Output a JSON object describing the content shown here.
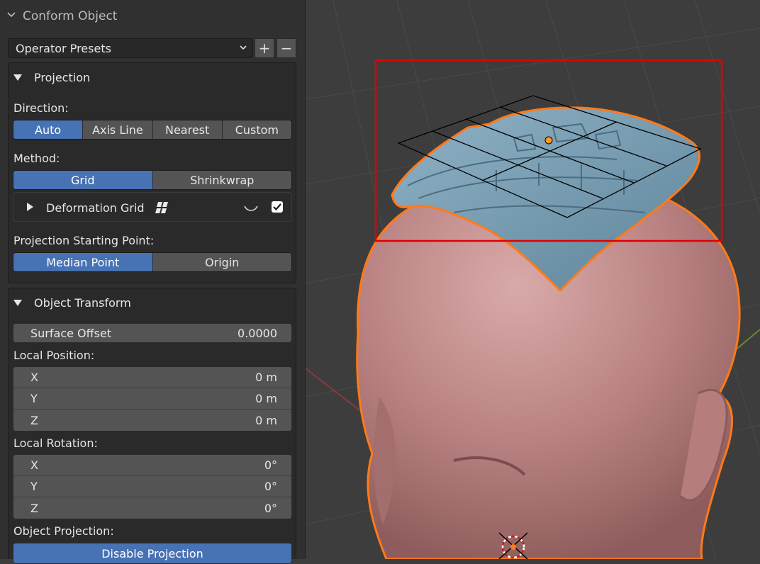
{
  "panel": {
    "title": "Conform Object",
    "presets_label": "Operator Presets",
    "preset_add": "+",
    "preset_remove": "−"
  },
  "projection": {
    "title": "Projection",
    "direction_label": "Direction:",
    "direction_options": [
      "Auto",
      "Axis Line",
      "Nearest",
      "Custom"
    ],
    "direction_selected": "Auto",
    "method_label": "Method:",
    "method_options": [
      "Grid",
      "Shrinkwrap"
    ],
    "method_selected": "Grid",
    "deformation_grid_label": "Deformation Grid",
    "deformation_grid_enabled": true,
    "start_label": "Projection Starting Point:",
    "start_options": [
      "Median Point",
      "Origin"
    ],
    "start_selected": "Median Point"
  },
  "transform": {
    "title": "Object Transform",
    "surface_offset_label": "Surface Offset",
    "surface_offset_value": "0.0000",
    "local_position_label": "Local Position:",
    "position": [
      {
        "axis": "X",
        "value": "0 m"
      },
      {
        "axis": "Y",
        "value": "0 m"
      },
      {
        "axis": "Z",
        "value": "0 m"
      }
    ],
    "local_rotation_label": "Local Rotation:",
    "rotation": [
      {
        "axis": "X",
        "value": "0°"
      },
      {
        "axis": "Y",
        "value": "0°"
      },
      {
        "axis": "Z",
        "value": "0°"
      }
    ],
    "object_projection_label": "Object Projection:",
    "disable_projection_label": "Disable Projection"
  },
  "colors": {
    "accent": "#4772b3",
    "selection_outline": "#ff7a1a",
    "highlight_box": "#e00000",
    "head_skin": "#c98f8f",
    "mesh_blue": "#7fa2b8"
  }
}
